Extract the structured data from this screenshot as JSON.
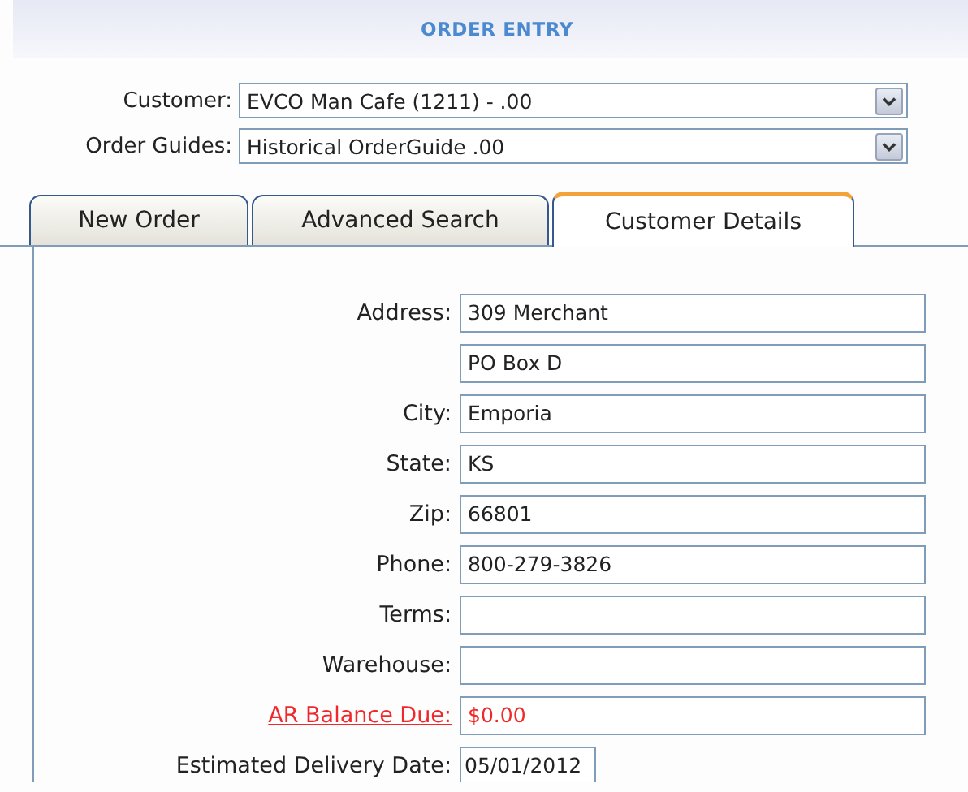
{
  "header": {
    "title": "ORDER ENTRY"
  },
  "selectors": [
    {
      "label": "Customer:",
      "value": "EVCO Man Cafe (1211) - .00"
    },
    {
      "label": "Order Guides:",
      "value": "Historical OrderGuide .00"
    }
  ],
  "tabs": [
    {
      "label": "New Order",
      "selected": false
    },
    {
      "label": "Advanced Search",
      "selected": false
    },
    {
      "label": "Customer Details",
      "selected": true
    }
  ],
  "fields": [
    {
      "kind": "plain",
      "label": "Address:",
      "value": "309 Merchant"
    },
    {
      "kind": "plain",
      "value": "PO Box D"
    },
    {
      "kind": "plain",
      "label": "City:",
      "value": "Emporia"
    },
    {
      "kind": "plain",
      "label": "State:",
      "value": "KS"
    },
    {
      "kind": "plain",
      "label": "Zip:",
      "value": "66801"
    },
    {
      "kind": "plain",
      "label": "Phone:",
      "value": "800-279-3826"
    },
    {
      "kind": "plain",
      "label": "Terms:"
    },
    {
      "kind": "plain",
      "label": "Warehouse:"
    },
    {
      "kind": "alert",
      "label": "AR Balance Due:",
      "value": "$0.00"
    },
    {
      "kind": "date",
      "label": "Estimated Delivery Date:",
      "value": "05/01/2012"
    }
  ]
}
